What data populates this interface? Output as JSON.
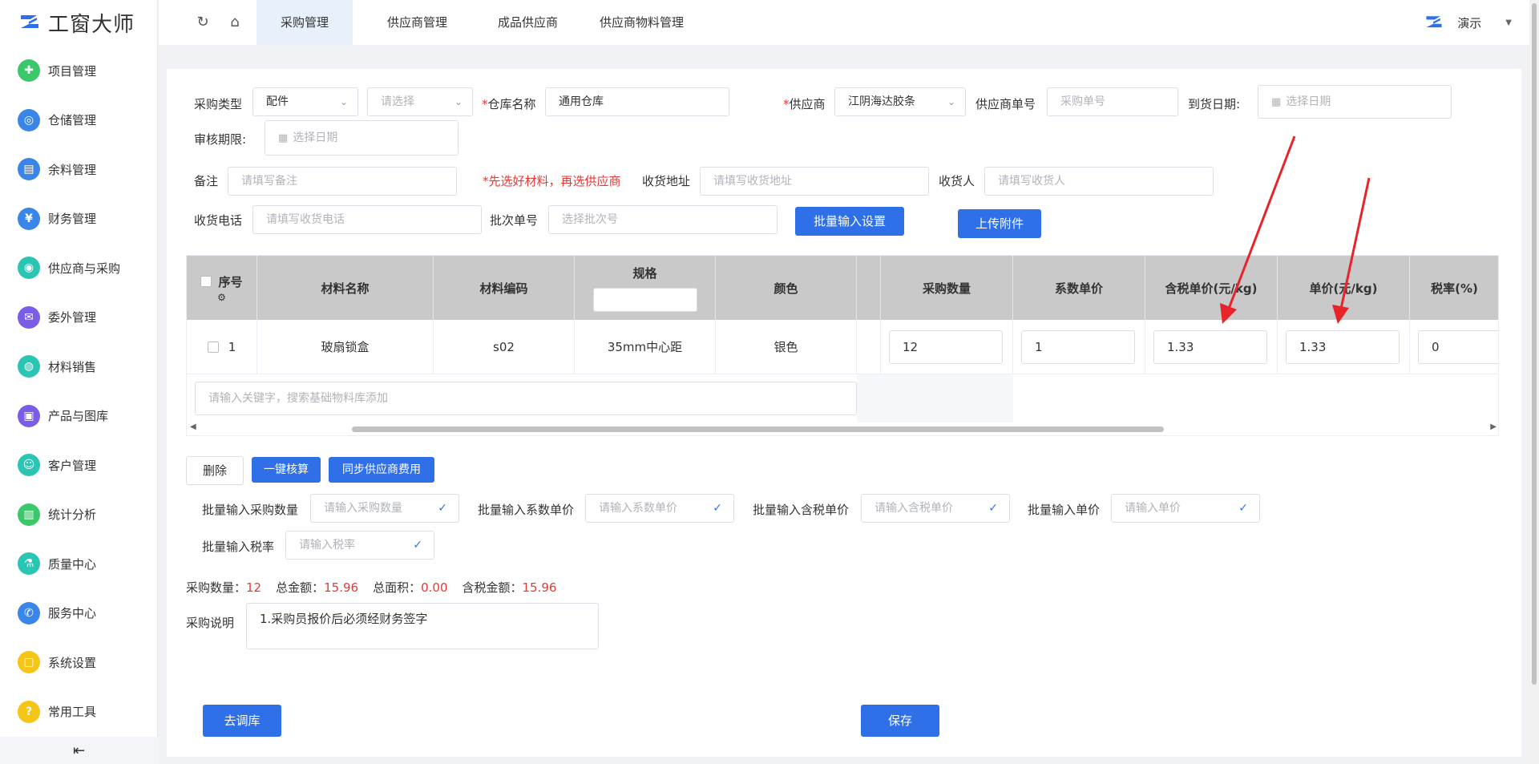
{
  "app": {
    "title": "工窗大师"
  },
  "sidebar": {
    "items": [
      {
        "label": "项目管理",
        "icon": "project-icon",
        "color": "#3cc76a"
      },
      {
        "label": "仓储管理",
        "icon": "warehouse-icon",
        "color": "#3a86e8"
      },
      {
        "label": "余料管理",
        "icon": "surplus-icon",
        "color": "#3a86e8"
      },
      {
        "label": "财务管理",
        "icon": "finance-icon",
        "color": "#3a86e8"
      },
      {
        "label": "供应商与采购",
        "icon": "supplier-icon",
        "color": "#2bc5b4"
      },
      {
        "label": "委外管理",
        "icon": "outsource-icon",
        "color": "#7b5ce6"
      },
      {
        "label": "材料销售",
        "icon": "material-sale-icon",
        "color": "#2bc5b4"
      },
      {
        "label": "产品与图库",
        "icon": "product-icon",
        "color": "#7b5ce6"
      },
      {
        "label": "客户管理",
        "icon": "customer-icon",
        "color": "#2bc5b4"
      },
      {
        "label": "统计分析",
        "icon": "stats-icon",
        "color": "#3cc76a"
      },
      {
        "label": "质量中心",
        "icon": "quality-icon",
        "color": "#2bc5b4"
      },
      {
        "label": "服务中心",
        "icon": "service-icon",
        "color": "#3a86e8"
      },
      {
        "label": "系统设置",
        "icon": "settings-icon",
        "color": "#f5c518"
      },
      {
        "label": "常用工具",
        "icon": "tools-icon",
        "color": "#f5c518"
      }
    ],
    "collapse_icon": "collapse-icon"
  },
  "topbar": {
    "tabs": [
      "采购管理",
      "供应商管理",
      "成品供应商",
      "供应商物料管理"
    ],
    "active_tab": 0,
    "user": "演示"
  },
  "form": {
    "purchase_type_label": "采购类型",
    "purchase_type_value": "配件",
    "sub_type_placeholder": "请选择",
    "warehouse_label": "仓库名称",
    "warehouse_value": "通用仓库",
    "supplier_label": "供应商",
    "supplier_value": "江阴海达胶条",
    "supplier_no_label": "供应商单号",
    "supplier_no_placeholder": "采购单号",
    "arrival_label": "到货日期:",
    "arrival_placeholder": "选择日期",
    "audit_label": "审核期限:",
    "audit_placeholder": "选择日期",
    "remark_label": "备注",
    "remark_placeholder": "请填写备注",
    "warning": "*先选好材料，再选供应商",
    "address_label": "收货地址",
    "address_placeholder": "请填写收货地址",
    "receiver_label": "收货人",
    "receiver_placeholder": "请填写收货人",
    "phone_label": "收货电话",
    "phone_placeholder": "请填写收货电话",
    "batch_label": "批次单号",
    "batch_placeholder": "选择批次号",
    "batch_setting_btn": "批量输入设置",
    "upload_btn": "上传附件",
    "required_mark": "*"
  },
  "table": {
    "headers": {
      "index": "序号",
      "name": "材料名称",
      "code": "材料编码",
      "spec": "规格",
      "color": "颜色",
      "qty": "采购数量",
      "coef": "系数单价",
      "tax_price": "含税单价(元/kg)",
      "price": "单价(元/kg)",
      "tax_rate": "税率(%)"
    },
    "rows": [
      {
        "index": "1",
        "name": "玻扇锁盒",
        "code": "s02",
        "spec": "35mm中心距",
        "color": "银色",
        "qty": "12",
        "coef": "1",
        "tax_price": "1.33",
        "price": "1.33",
        "tax_rate": "0"
      }
    ],
    "search_placeholder": "请输入关键字，搜索基础物料库添加"
  },
  "actions": {
    "delete": "删除",
    "calc": "一键核算",
    "sync": "同步供应商费用"
  },
  "batch": {
    "qty_label": "批量输入采购数量",
    "qty_placeholder": "请输入采购数量",
    "coef_label": "批量输入系数单价",
    "coef_placeholder": "请输入系数单价",
    "tax_price_label": "批量输入含税单价",
    "tax_price_placeholder": "请输入含税单价",
    "price_label": "批量输入单价",
    "price_placeholder": "请输入单价",
    "tax_rate_label": "批量输入税率",
    "tax_rate_placeholder": "请输入税率"
  },
  "summary": {
    "qty_label": "采购数量：",
    "qty_value": "12",
    "total_label": "总金额：",
    "total_value": "15.96",
    "area_label": "总面积：",
    "area_value": "0.00",
    "tax_total_label": "含税金额：",
    "tax_total_value": "15.96"
  },
  "note": {
    "label": "采购说明",
    "value": "1.采购员报价后必须经财务签字"
  },
  "footer": {
    "transfer_btn": "去调库",
    "save_btn": "保存"
  },
  "colors": {
    "primary": "#2f6fe8",
    "danger": "#e53935",
    "annotation": "#e8242a"
  }
}
